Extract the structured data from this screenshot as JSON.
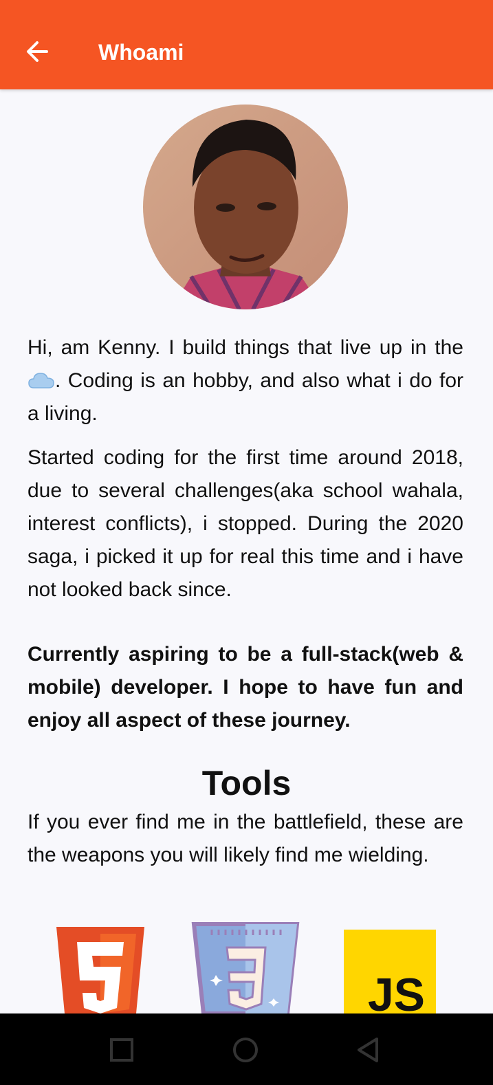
{
  "app_bar": {
    "title": "Whoami",
    "back_icon": "arrow-left-icon"
  },
  "profile": {
    "avatar": "profile-photo"
  },
  "about": {
    "intro_part1": "Hi, am Kenny. I build things that live up in the ",
    "cloud_icon": "cloud-icon",
    "intro_part2": ". Coding is an hobby, and also what i do for a living.",
    "story": "Started coding for the first time around 2018, due to several challenges(aka school wahala, interest conflicts), i stopped. During the 2020 saga, i picked it up for real this time and i have not looked back since.",
    "aspiration": "Currently aspiring to be a full-stack(web & mobile) developer. I hope to have fun and enjoy all aspect of these journey."
  },
  "tools": {
    "title": "Tools",
    "description": "If you ever find me in the battlefield, these are the weapons you will likely find me wielding.",
    "icons": [
      {
        "name": "html5-icon",
        "color": "#e44d26"
      },
      {
        "name": "css3-icon",
        "color": "#8aa9dc"
      },
      {
        "name": "javascript-icon",
        "label": "JS",
        "color": "#f7df1e"
      }
    ]
  },
  "colors": {
    "primary": "#f55523",
    "background": "#f8f8fc",
    "nav_bar": "#000000"
  },
  "system_nav": {
    "icons": [
      "recents-icon",
      "home-icon",
      "back-icon"
    ]
  }
}
